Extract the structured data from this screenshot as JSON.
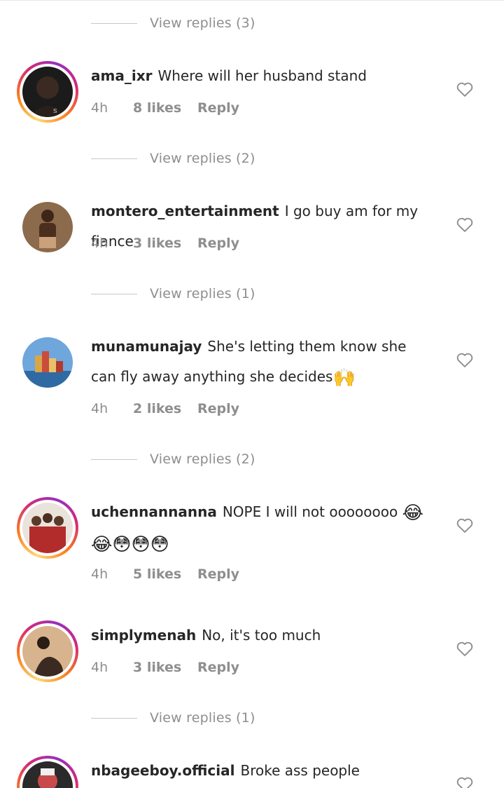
{
  "comments": [
    {
      "username": "",
      "text": "",
      "view_replies": "View replies (3)"
    },
    {
      "username": "ama_ixr",
      "text": "Where will her husband stand",
      "time": "4h",
      "likes": "8 likes",
      "reply": "Reply",
      "view_replies": "View replies (2)",
      "avatar_color": "#1b1b1b",
      "has_story_ring": true
    },
    {
      "username": "montero_entertainment",
      "text": "I go buy am for my fiance",
      "time": "4h",
      "likes": "3 likes",
      "reply": "Reply",
      "view_replies": "View replies (1)",
      "avatar_color": "#6b4a33",
      "has_story_ring": false
    },
    {
      "username": "munamunajay",
      "text": "She's letting them know she can fly away anything she decides",
      "emoji": "🙌",
      "time": "4h",
      "likes": "2 likes",
      "reply": "Reply",
      "view_replies": "View replies (2)",
      "avatar_color": "#4f86c6",
      "has_story_ring": false
    },
    {
      "username": "uchennannanna",
      "text": "NOPE I will not oooooooo",
      "emoji": "😂😂😳😳😳",
      "time": "4h",
      "likes": "5 likes",
      "reply": "Reply",
      "avatar_color": "#b32c2c",
      "has_story_ring": true
    },
    {
      "username": "simplymenah",
      "text": "No, it's too much",
      "time": "4h",
      "likes": "3 likes",
      "reply": "Reply",
      "view_replies": "View replies (1)",
      "avatar_color": "#c8a27a",
      "has_story_ring": true
    },
    {
      "username": "nbageeboy.official",
      "text": "Broke ass people",
      "avatar_color": "#2a2a2a",
      "has_story_ring": true
    }
  ],
  "colors": {
    "text": "#262626",
    "muted": "#8e8e8e"
  },
  "icons": {
    "like": "heart-outline-icon"
  }
}
